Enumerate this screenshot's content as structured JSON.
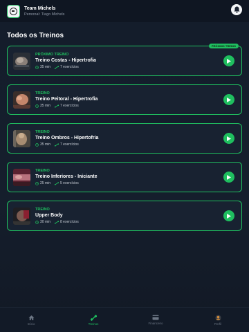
{
  "header": {
    "team_name": "Team Michels",
    "trainer": "Personal: Tiago Michels"
  },
  "section_title": "Todos os Treinos",
  "workouts": [
    {
      "tag": "PRÓXIMO TREINO",
      "name": "Treino Costas - Hipertrofia",
      "duration": "35 min",
      "exercises": "7 exercícios",
      "badge": "PRÓXIMO TREINO"
    },
    {
      "tag": "TREINO",
      "name": "Treino Peitoral - Hipertrofia",
      "duration": "35 min",
      "exercises": "7 exercícios"
    },
    {
      "tag": "TREINO",
      "name": "Treino Ombros - Hipertofria",
      "duration": "35 min",
      "exercises": "7 exercícios"
    },
    {
      "tag": "TREINO",
      "name": "Treino Inferiores - Iniciante",
      "duration": "25 min",
      "exercises": "5 exercícios"
    },
    {
      "tag": "TREINO",
      "name": "Upper Body",
      "duration": "30 min",
      "exercises": "8 exercícios"
    }
  ],
  "tabs": [
    {
      "label": "Início",
      "icon": "home-icon",
      "active": false
    },
    {
      "label": "Treinos",
      "icon": "dumbbell-icon",
      "active": true
    },
    {
      "label": "Financeiro",
      "icon": "card-icon",
      "active": false
    },
    {
      "label": "Perfil",
      "icon": "avatar-icon",
      "active": false
    }
  ],
  "colors": {
    "accent": "#1fbf5f",
    "background": "#141d2b",
    "card": "#182231"
  }
}
